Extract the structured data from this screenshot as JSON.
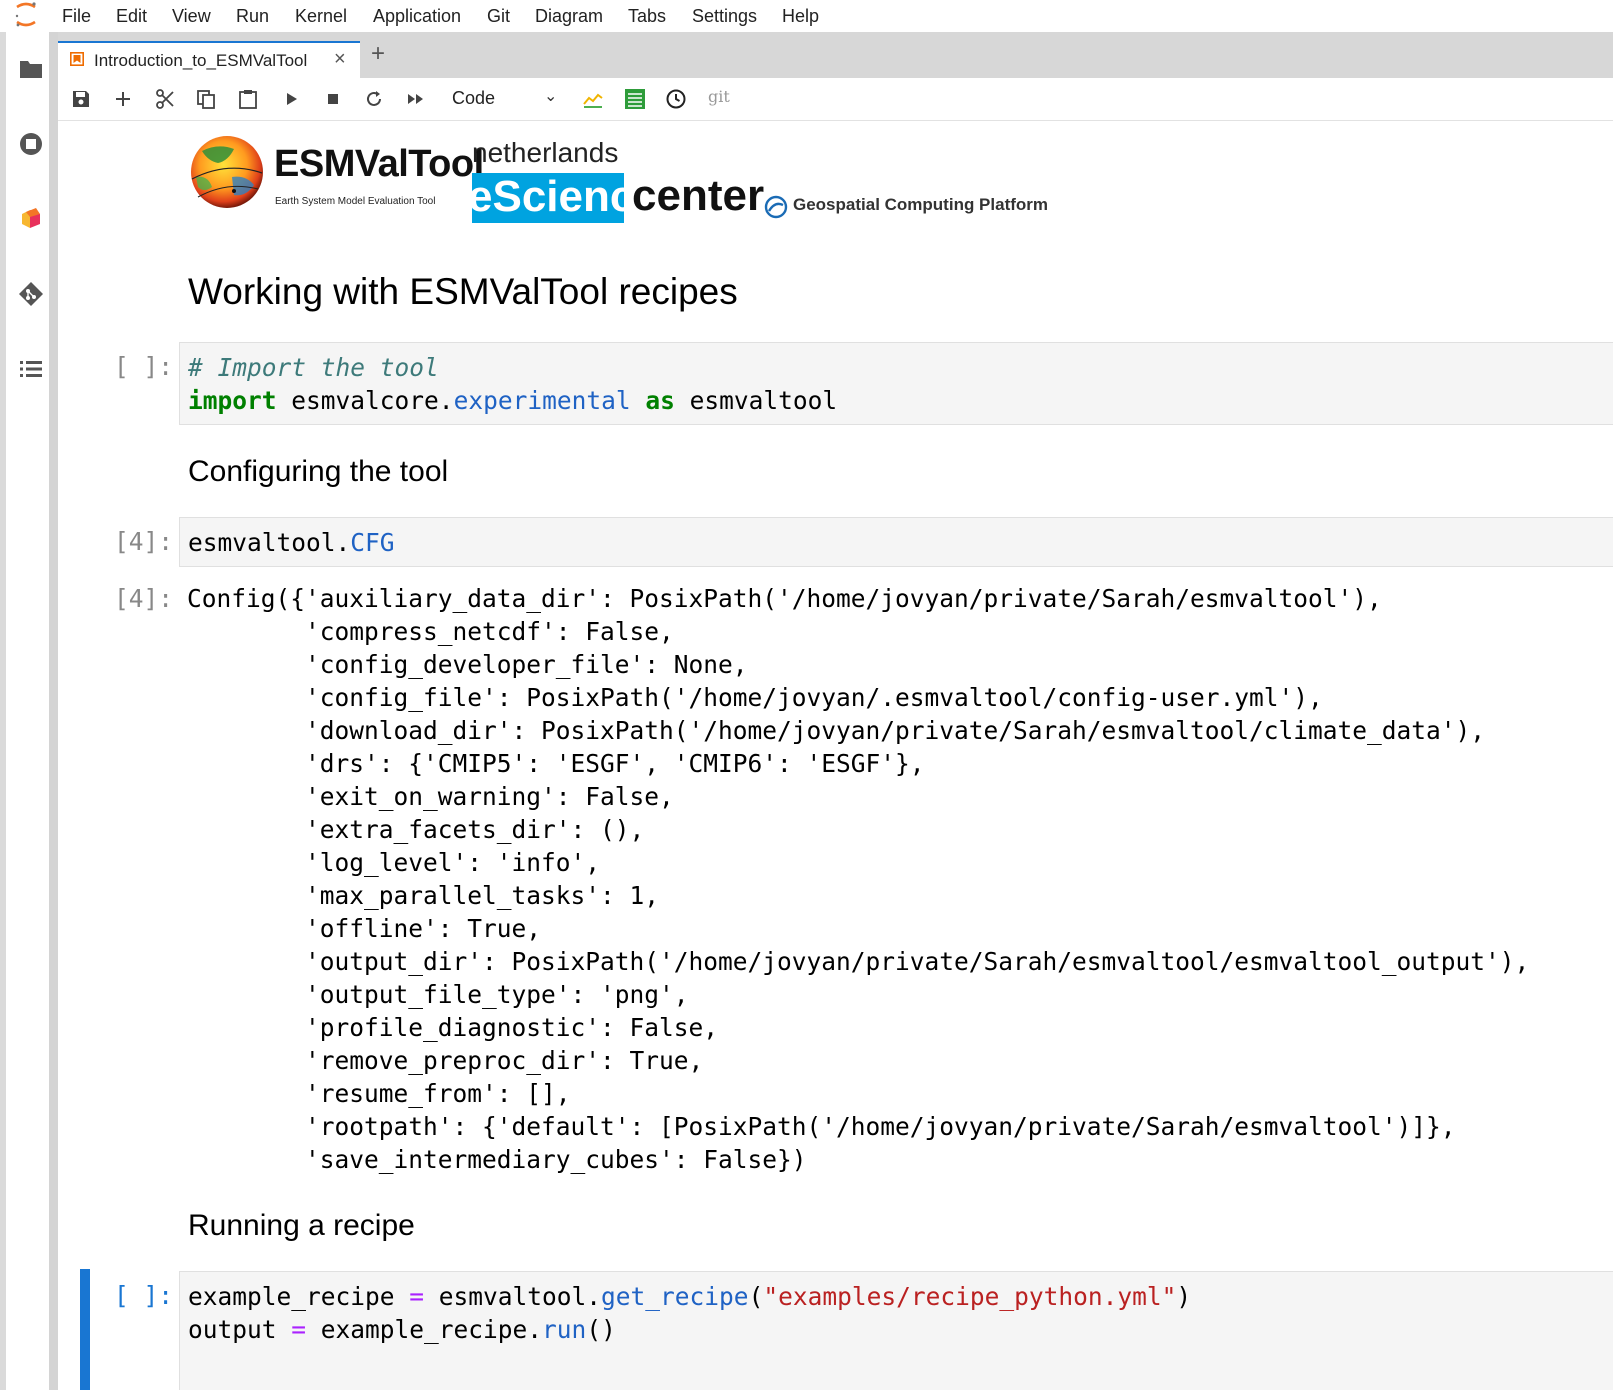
{
  "menu": [
    "File",
    "Edit",
    "View",
    "Run",
    "Kernel",
    "Application",
    "Git",
    "Diagram",
    "Tabs",
    "Settings",
    "Help"
  ],
  "tab": {
    "title": "Introduction_to_ESMValTool",
    "close": "×",
    "add": "+"
  },
  "toolbar": {
    "cell_type": "Code",
    "git_label": "git"
  },
  "logos": {
    "esmvaltool_title": "ESMValTool",
    "esmvaltool_subtitle": "Earth System Model Evaluation Tool",
    "nlesc_top": "netherlands",
    "nlesc_science": "eScience",
    "nlesc_center": "center",
    "gcp": "Geospatial Computing Platform"
  },
  "headings": {
    "title": "Working with ESMValTool recipes",
    "configuring": "Configuring the tool",
    "running": "Running a recipe"
  },
  "cells": {
    "import_prompt": "[ ]:",
    "import_comment": "# Import the tool",
    "import_kw1": "import",
    "import_mod": "esmvalcore",
    "import_dot": ".",
    "import_attr": "experimental",
    "import_kw2": "as",
    "import_alias": "esmvaltool",
    "cfg_prompt": "[4]:",
    "cfg_obj": "esmvaltool",
    "cfg_dot": ".",
    "cfg_attr": "CFG",
    "out_prompt": "[4]:",
    "output_lines": [
      "Config({'auxiliary_data_dir': PosixPath('/home/jovyan/private/Sarah/esmvaltool'),",
      "        'compress_netcdf': False,",
      "        'config_developer_file': None,",
      "        'config_file': PosixPath('/home/jovyan/.esmvaltool/config-user.yml'),",
      "        'download_dir': PosixPath('/home/jovyan/private/Sarah/esmvaltool/climate_data'),",
      "        'drs': {'CMIP5': 'ESGF', 'CMIP6': 'ESGF'},",
      "        'exit_on_warning': False,",
      "        'extra_facets_dir': (),",
      "        'log_level': 'info',",
      "        'max_parallel_tasks': 1,",
      "        'offline': True,",
      "        'output_dir': PosixPath('/home/jovyan/private/Sarah/esmvaltool/esmvaltool_output'),",
      "        'output_file_type': 'png',",
      "        'profile_diagnostic': False,",
      "        'remove_preproc_dir': True,",
      "        'resume_from': [],",
      "        'rootpath': {'default': [PosixPath('/home/jovyan/private/Sarah/esmvaltool')]},",
      "        'save_intermediary_cubes': False})"
    ],
    "run_prompt": "[ ]:",
    "run_l1_var": "example_recipe ",
    "run_l1_eq": "=",
    "run_l1_obj": " esmvaltool.",
    "run_l1_fn": "get_recipe",
    "run_l1_open": "(",
    "run_l1_str": "\"examples/recipe_python.yml\"",
    "run_l1_close": ")",
    "run_l2_var": "output ",
    "run_l2_eq": "=",
    "run_l2_obj": " example_recipe.",
    "run_l2_fn": "run",
    "run_l2_paren": "()"
  },
  "colors": {
    "accent": "#1976d2",
    "keyword": "#008000",
    "string": "#ba2121",
    "attribute": "#1f62c4"
  }
}
